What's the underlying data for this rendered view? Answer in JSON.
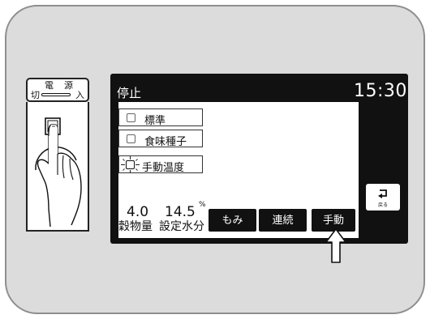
{
  "power_switch": {
    "label_top_left": "電",
    "label_top_right": "源",
    "label_off": "切",
    "label_on": "入"
  },
  "screen": {
    "status": "停止",
    "time": "15:30",
    "menu_items": [
      {
        "label": "標準"
      },
      {
        "label": "食味種子"
      },
      {
        "label": "手動温度",
        "state": "lit"
      }
    ],
    "grain_amount": {
      "value": "4.0",
      "label": "穀物量"
    },
    "moisture": {
      "value": "14.5",
      "unit": "%",
      "label": "設定水分"
    },
    "buttons": [
      {
        "label": "もみ"
      },
      {
        "label": "連続"
      },
      {
        "label": "手動"
      }
    ],
    "back_button": {
      "label": "戻る"
    }
  },
  "icons": {
    "hand": "hand-pressing-icon",
    "up_arrow": "up-arrow-icon",
    "back": "return-arrow-icon"
  }
}
